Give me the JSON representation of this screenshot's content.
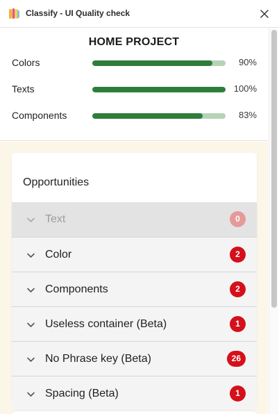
{
  "window": {
    "title": "Classify - UI Quality check",
    "logo_icon": "classify-logo-icon",
    "close_icon": "close-icon"
  },
  "summary": {
    "project_title": "HOME PROJECT",
    "metrics": [
      {
        "label": "Colors",
        "value": "90%",
        "fill": 0.9
      },
      {
        "label": "Texts",
        "value": "100%",
        "fill": 1.0
      },
      {
        "label": "Components",
        "value": "83%",
        "fill": 0.83
      }
    ],
    "colors": {
      "fill": "#2f7d3a",
      "track": "#b5d3b7"
    }
  },
  "opportunities": {
    "title": "Opportunities",
    "items": [
      {
        "label": "Text",
        "count": "0",
        "disabled": true
      },
      {
        "label": "Color",
        "count": "2",
        "disabled": false
      },
      {
        "label": "Components",
        "count": "2",
        "disabled": false
      },
      {
        "label": "Useless container (Beta)",
        "count": "1",
        "disabled": false
      },
      {
        "label": "No Phrase key (Beta)",
        "count": "26",
        "disabled": false
      },
      {
        "label": "Spacing (Beta)",
        "count": "1",
        "disabled": false
      }
    ],
    "badge_color": "#d4101a"
  }
}
